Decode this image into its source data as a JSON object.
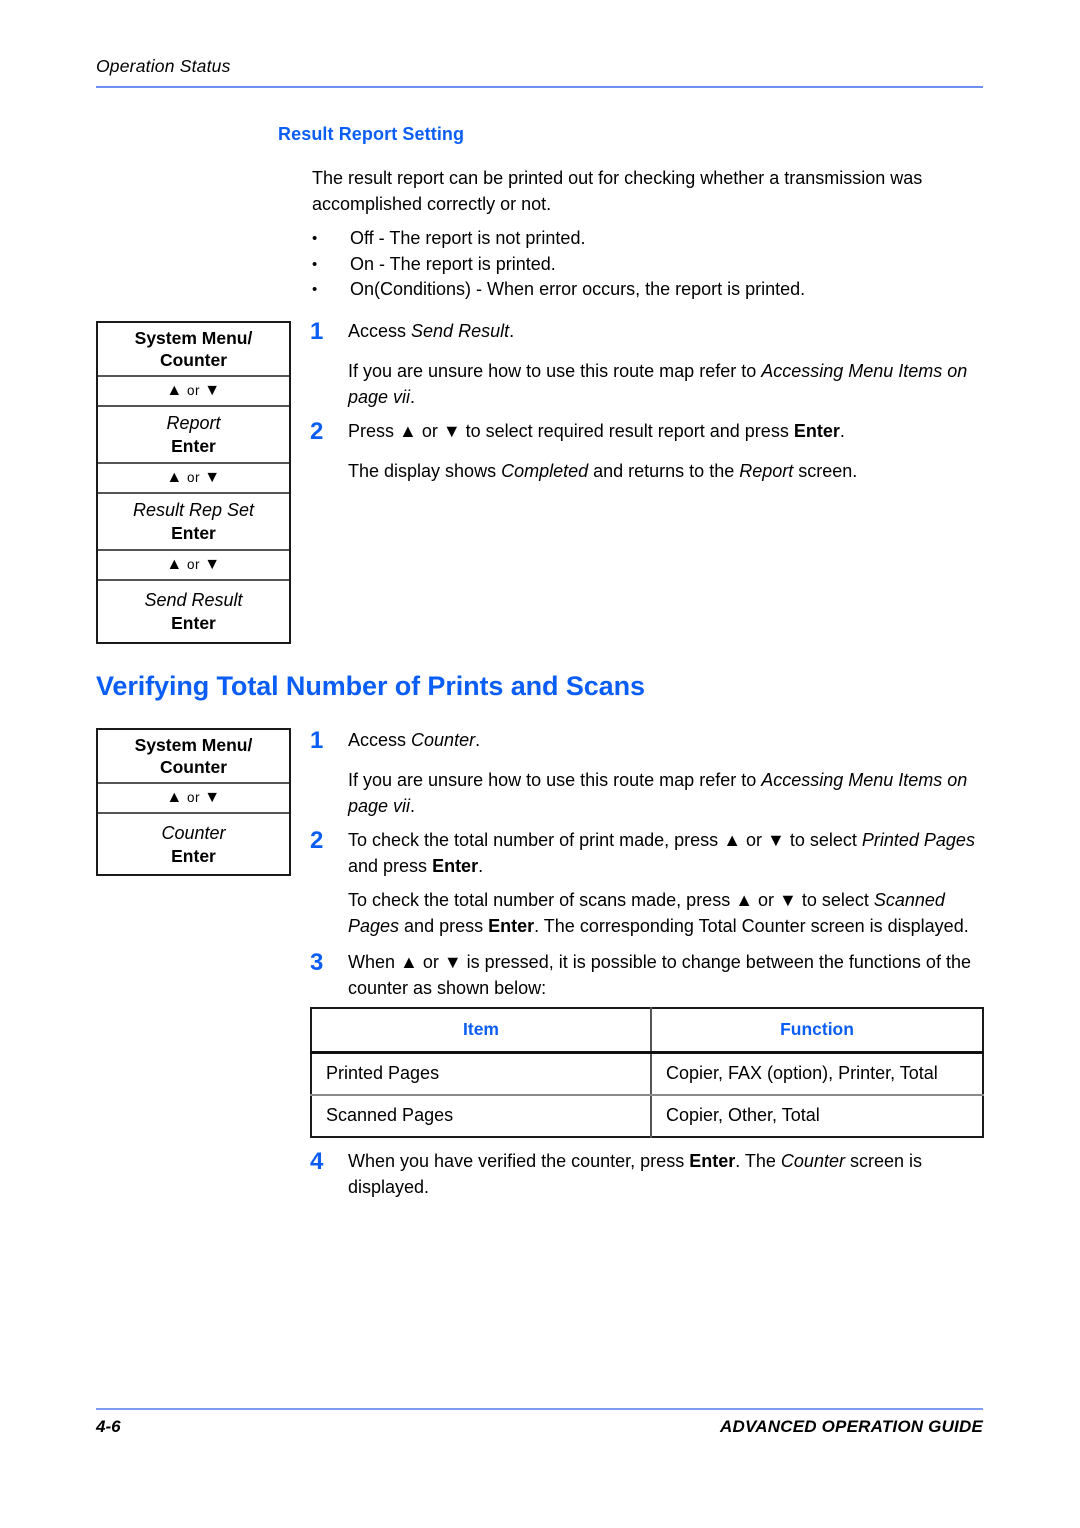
{
  "header": {
    "running_title": "Operation Status"
  },
  "subsection": {
    "title": "Result Report Setting",
    "intro": "The result report can be printed out for checking whether a transmission was accomplished correctly or not.",
    "bullets": [
      "Off - The report is not printed.",
      "On - The report is printed.",
      "On(Conditions) - When error occurs, the report is printed."
    ],
    "bullet_marker": "•"
  },
  "routemap1": {
    "rows": [
      {
        "type": "key",
        "text": "System Menu/\nCounter"
      },
      {
        "type": "arrow",
        "text": "▲ or ▼"
      },
      {
        "type": "item",
        "item": "Report",
        "enter": "Enter"
      },
      {
        "type": "arrow",
        "text": "▲ or ▼"
      },
      {
        "type": "item",
        "item": "Result Rep Set",
        "enter": "Enter"
      },
      {
        "type": "arrow",
        "text": "▲ or ▼"
      },
      {
        "type": "item",
        "item": "Send Result",
        "enter": "Enter"
      }
    ],
    "key_line1": "System Menu/",
    "key_line2": "Counter",
    "arrow_up": "▲",
    "arrow_or": "or",
    "arrow_down": "▼",
    "item_report": "Report",
    "item_result_rep_set": "Result Rep Set",
    "item_send_result": "Send Result",
    "enter": "Enter"
  },
  "routemap2": {
    "key_line1": "System Menu/",
    "key_line2": "Counter",
    "arrow_up": "▲",
    "arrow_or": "or",
    "arrow_down": "▼",
    "item_counter": "Counter",
    "enter": "Enter"
  },
  "steps_section1": [
    {
      "number": "1",
      "paragraphs": [
        {
          "parts": [
            {
              "t": "Access ",
              "s": "n"
            },
            {
              "t": "Send Result",
              "s": "i"
            },
            {
              "t": ".",
              "s": "n"
            }
          ]
        },
        {
          "parts": [
            {
              "t": "If you are unsure how to use this route map refer to ",
              "s": "n"
            },
            {
              "t": "Accessing Menu Items on page vii",
              "s": "i"
            },
            {
              "t": ".",
              "s": "n"
            }
          ]
        }
      ]
    },
    {
      "number": "2",
      "paragraphs": [
        {
          "parts": [
            {
              "t": "Press ▲ or ▼ to select required result report and press ",
              "s": "n"
            },
            {
              "t": "Enter",
              "s": "b"
            },
            {
              "t": ".",
              "s": "n"
            }
          ]
        },
        {
          "parts": [
            {
              "t": "The display shows ",
              "s": "n"
            },
            {
              "t": "Completed",
              "s": "i"
            },
            {
              "t": " and returns to the ",
              "s": "n"
            },
            {
              "t": "Report",
              "s": "i"
            },
            {
              "t": " screen.",
              "s": "n"
            }
          ]
        }
      ]
    }
  ],
  "section": {
    "title": "Verifying Total Number of Prints and Scans"
  },
  "steps_section2": [
    {
      "number": "1",
      "paragraphs": [
        {
          "parts": [
            {
              "t": "Access ",
              "s": "n"
            },
            {
              "t": "Counter",
              "s": "i"
            },
            {
              "t": ".",
              "s": "n"
            }
          ]
        },
        {
          "parts": [
            {
              "t": "If you are unsure how to use this route map refer to ",
              "s": "n"
            },
            {
              "t": "Accessing Menu Items on page vii",
              "s": "i"
            },
            {
              "t": ".",
              "s": "n"
            }
          ]
        }
      ]
    },
    {
      "number": "2",
      "paragraphs": [
        {
          "parts": [
            {
              "t": "To check the total number of print made, press ▲ or ▼ to select ",
              "s": "n"
            },
            {
              "t": "Printed Pages",
              "s": "i"
            },
            {
              "t": " and press ",
              "s": "n"
            },
            {
              "t": "Enter",
              "s": "b"
            },
            {
              "t": ".",
              "s": "n"
            }
          ]
        },
        {
          "parts": [
            {
              "t": "To check the total number of scans made, press ▲ or ▼ to select ",
              "s": "n"
            },
            {
              "t": "Scanned Pages",
              "s": "i"
            },
            {
              "t": " and press ",
              "s": "n"
            },
            {
              "t": "Enter",
              "s": "b"
            },
            {
              "t": ". The corresponding Total Counter screen is displayed.",
              "s": "n"
            }
          ]
        }
      ]
    },
    {
      "number": "3",
      "paragraphs": [
        {
          "parts": [
            {
              "t": "When ▲ or ▼ is pressed, it is possible to change between the functions of the counter as shown below:",
              "s": "n"
            }
          ]
        }
      ]
    }
  ],
  "step4": {
    "number": "4",
    "paragraphs": [
      {
        "parts": [
          {
            "t": "When you have verified the counter, press ",
            "s": "n"
          },
          {
            "t": "Enter",
            "s": "b"
          },
          {
            "t": ". The ",
            "s": "n"
          },
          {
            "t": "Counter",
            "s": "i"
          },
          {
            "t": " screen is displayed.",
            "s": "n"
          }
        ]
      }
    ]
  },
  "counter_table": {
    "headers": [
      "Item",
      "Function"
    ],
    "rows": [
      [
        "Printed Pages",
        "Copier, FAX (option), Printer, Total"
      ],
      [
        "Scanned Pages",
        "Copier, Other, Total"
      ]
    ]
  },
  "footer": {
    "page_number": "4-6",
    "guide_title": "ADVANCED OPERATION GUIDE"
  },
  "colors": {
    "accent_blue": "#0b5ef5",
    "rule_blue": "#6e8ff2",
    "text_black": "#000000"
  }
}
